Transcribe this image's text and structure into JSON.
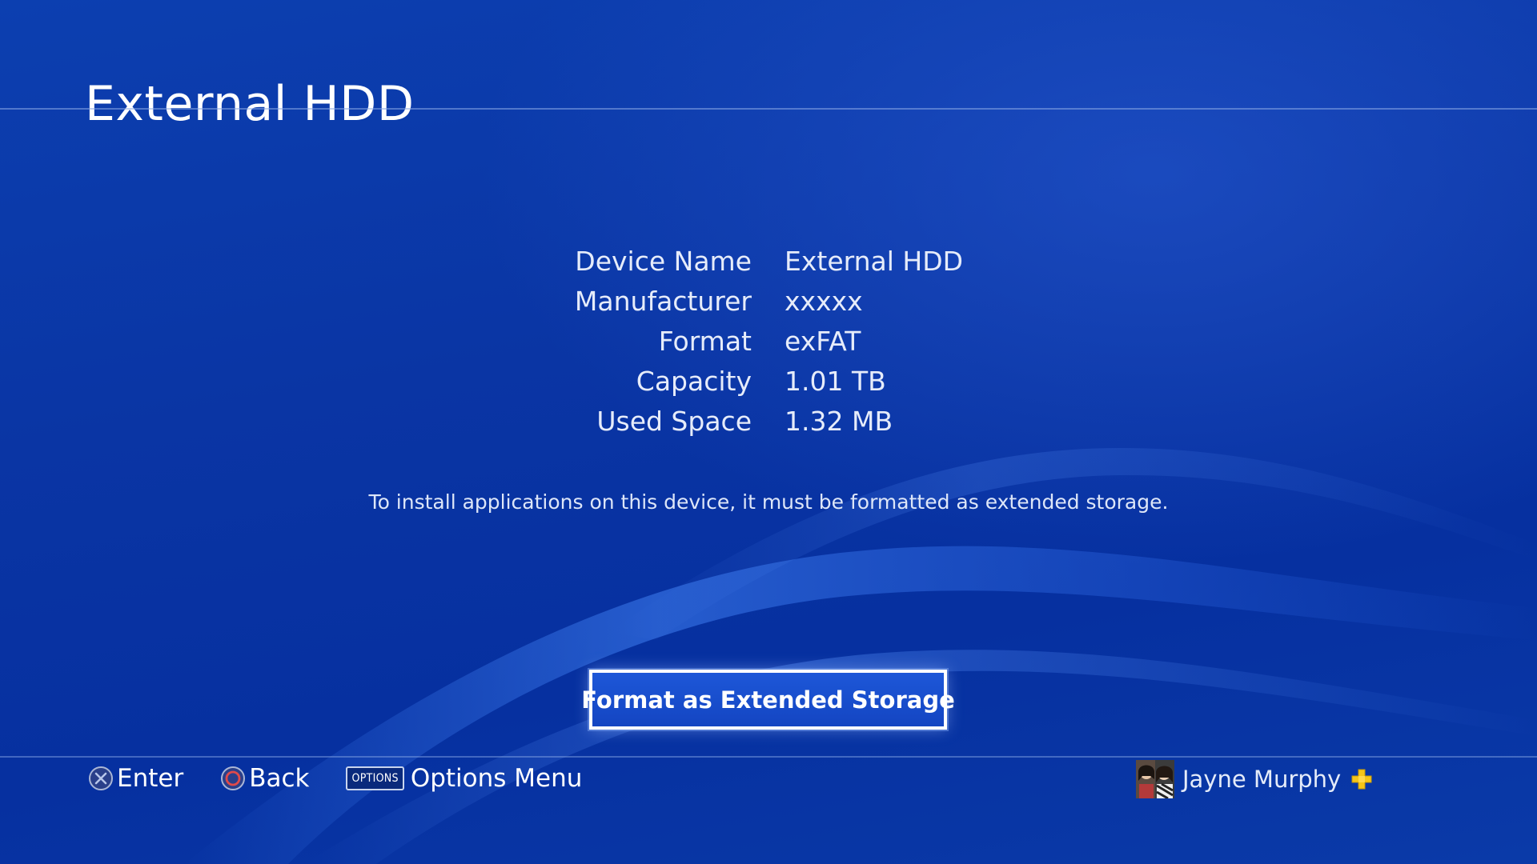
{
  "header": {
    "title": "External HDD"
  },
  "device_info": {
    "rows": [
      {
        "label": "Device Name",
        "value": "External HDD"
      },
      {
        "label": "Manufacturer",
        "value": "xxxxx"
      },
      {
        "label": "Format",
        "value": "exFAT"
      },
      {
        "label": "Capacity",
        "value": "1.01 TB"
      },
      {
        "label": "Used Space",
        "value": "1.32 MB"
      }
    ]
  },
  "notice": "To install applications on this device, it must be formatted as extended storage.",
  "actions": {
    "format_label": "Format as Extended Storage"
  },
  "controls": {
    "enter_label": "Enter",
    "back_label": "Back",
    "options_badge": "OPTIONS",
    "options_label": "Options Menu"
  },
  "user": {
    "name": "Jayne Murphy"
  },
  "icons": {
    "enter": "cross-button-icon",
    "back": "circle-button-icon",
    "options": "options-button-icon",
    "plus": "ps-plus-icon"
  },
  "colors": {
    "background": "#0a35a4",
    "button_face": "#1d57d8",
    "button_border": "#ffffff",
    "back_circle": "#e04a4a",
    "plus_gold": "#f5c518"
  }
}
